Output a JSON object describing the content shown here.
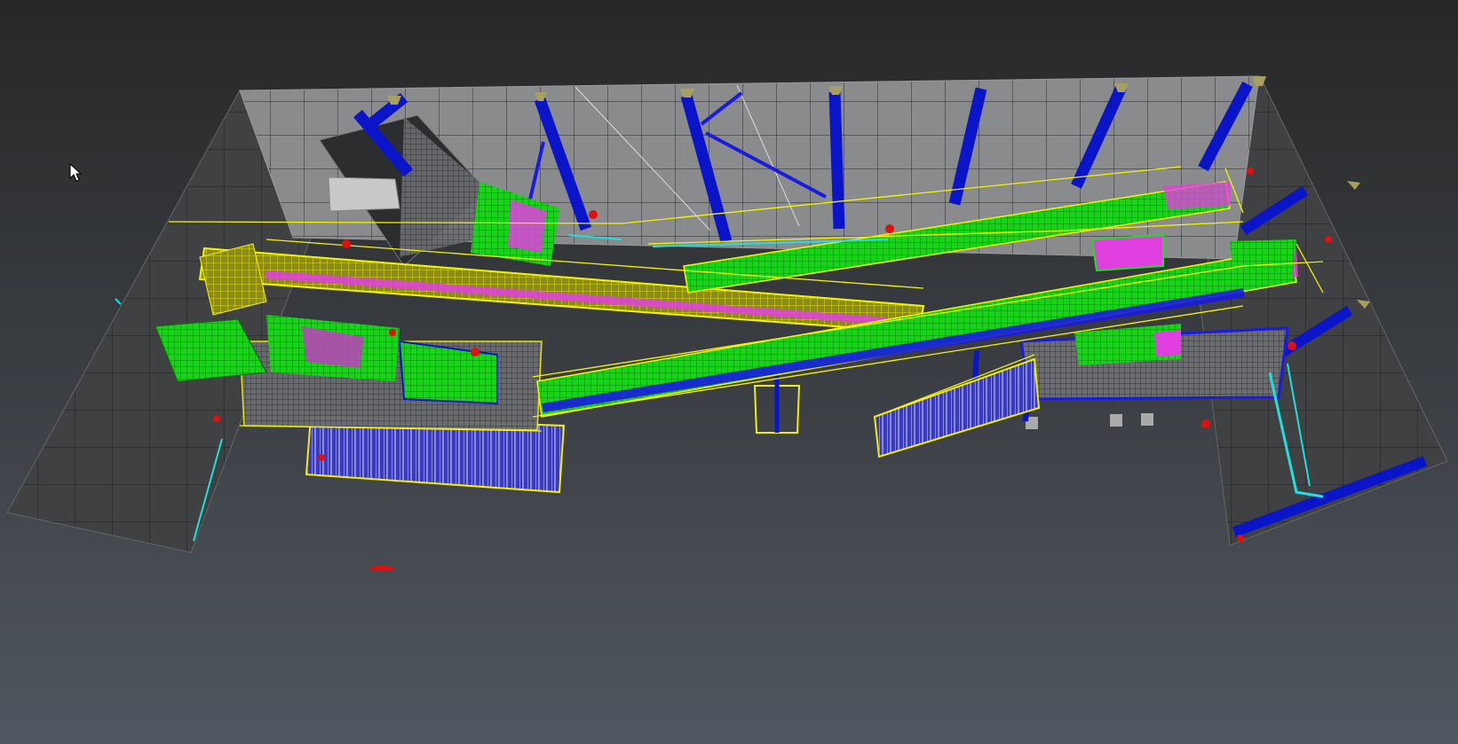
{
  "viewport": {
    "mode": "wireframe-3d",
    "background_top": "#262728",
    "background_bottom": "#505760"
  },
  "colors": {
    "floor_wall": "#4a4b4c",
    "wall_light": "#8c8c8c",
    "grid": "#1c1c1c",
    "steel_columns": "#0a14c8",
    "handrails": "#f0f000",
    "conveyor_green": "#20e020",
    "motors_magenta": "#e040e0",
    "cyan_pipes": "#20e0e0",
    "warning_red": "#e01010"
  },
  "icons": {
    "cursor": "mouse-pointer-icon"
  },
  "objects": [
    "back-wall",
    "left-wall",
    "right-wall",
    "steel-columns",
    "silo-block",
    "conveyor-yellow-upper",
    "conveyor-green-upper",
    "conveyor-green-lower",
    "hopper-green",
    "crusher-assembly",
    "motor-drives",
    "stair-platform-left",
    "stair-platform-center",
    "support-frame-right",
    "handrail-lines"
  ]
}
